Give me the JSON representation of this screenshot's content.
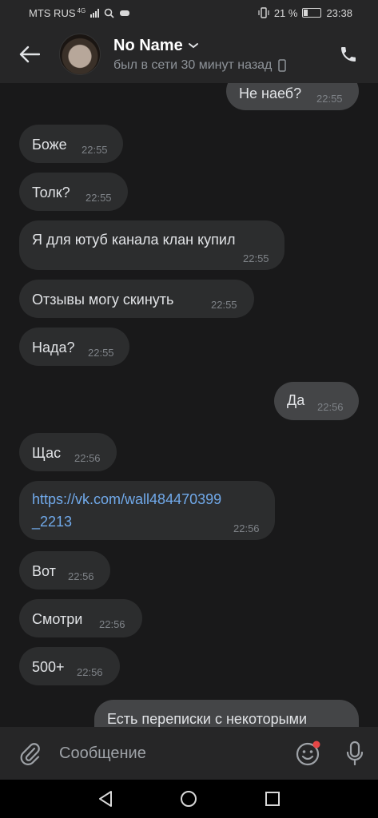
{
  "status_bar": {
    "carrier": "MTS RUS",
    "network": "4G",
    "battery": "21 %",
    "time": "23:38"
  },
  "header": {
    "contact_name": "No Name",
    "last_seen": "был в сети 30 минут назад"
  },
  "messages": [
    {
      "dir": "out",
      "lines": [
        "Не наеб?"
      ],
      "time": "22:55"
    },
    {
      "dir": "in",
      "lines": [
        "Боже"
      ],
      "time": "22:55"
    },
    {
      "dir": "in",
      "lines": [
        "Толк?"
      ],
      "time": "22:55"
    },
    {
      "dir": "in",
      "lines": [
        "Я для ютуб канала клан купил"
      ],
      "time": "22:55"
    },
    {
      "dir": "in",
      "lines": [
        "Отзывы могу скинуть"
      ],
      "time": "22:55"
    },
    {
      "dir": "in",
      "lines": [
        "Нада?"
      ],
      "time": "22:55"
    },
    {
      "dir": "out",
      "lines": [
        "Да"
      ],
      "time": "22:56"
    },
    {
      "dir": "in",
      "lines": [
        "Щас"
      ],
      "time": "22:56"
    },
    {
      "dir": "in",
      "lines": [
        "https://vk.com/wall484470399",
        "_2213"
      ],
      "time": "22:56",
      "is_link": true
    },
    {
      "dir": "in",
      "lines": [
        "Вот"
      ],
      "time": "22:56"
    },
    {
      "dir": "in",
      "lines": [
        "Смотри"
      ],
      "time": "22:56"
    },
    {
      "dir": "in",
      "lines": [
        "500+"
      ],
      "time": "22:56"
    },
    {
      "dir": "out",
      "lines": [
        "Есть переписки с некоторыми"
      ],
      "time": ""
    }
  ],
  "composer": {
    "placeholder": "Сообщение"
  },
  "colors": {
    "background": "#19191a",
    "incoming_bubble": "#2c2d2e",
    "outgoing_bubble": "#444547",
    "link": "#71aaeb",
    "unread_dot": "#e64646"
  },
  "icons": [
    "back-arrow-icon",
    "chevron-down-icon",
    "device-icon",
    "phone-icon",
    "paperclip-icon",
    "emoji-icon",
    "microphone-icon",
    "nav-back-icon",
    "nav-home-icon",
    "nav-recents-icon"
  ]
}
